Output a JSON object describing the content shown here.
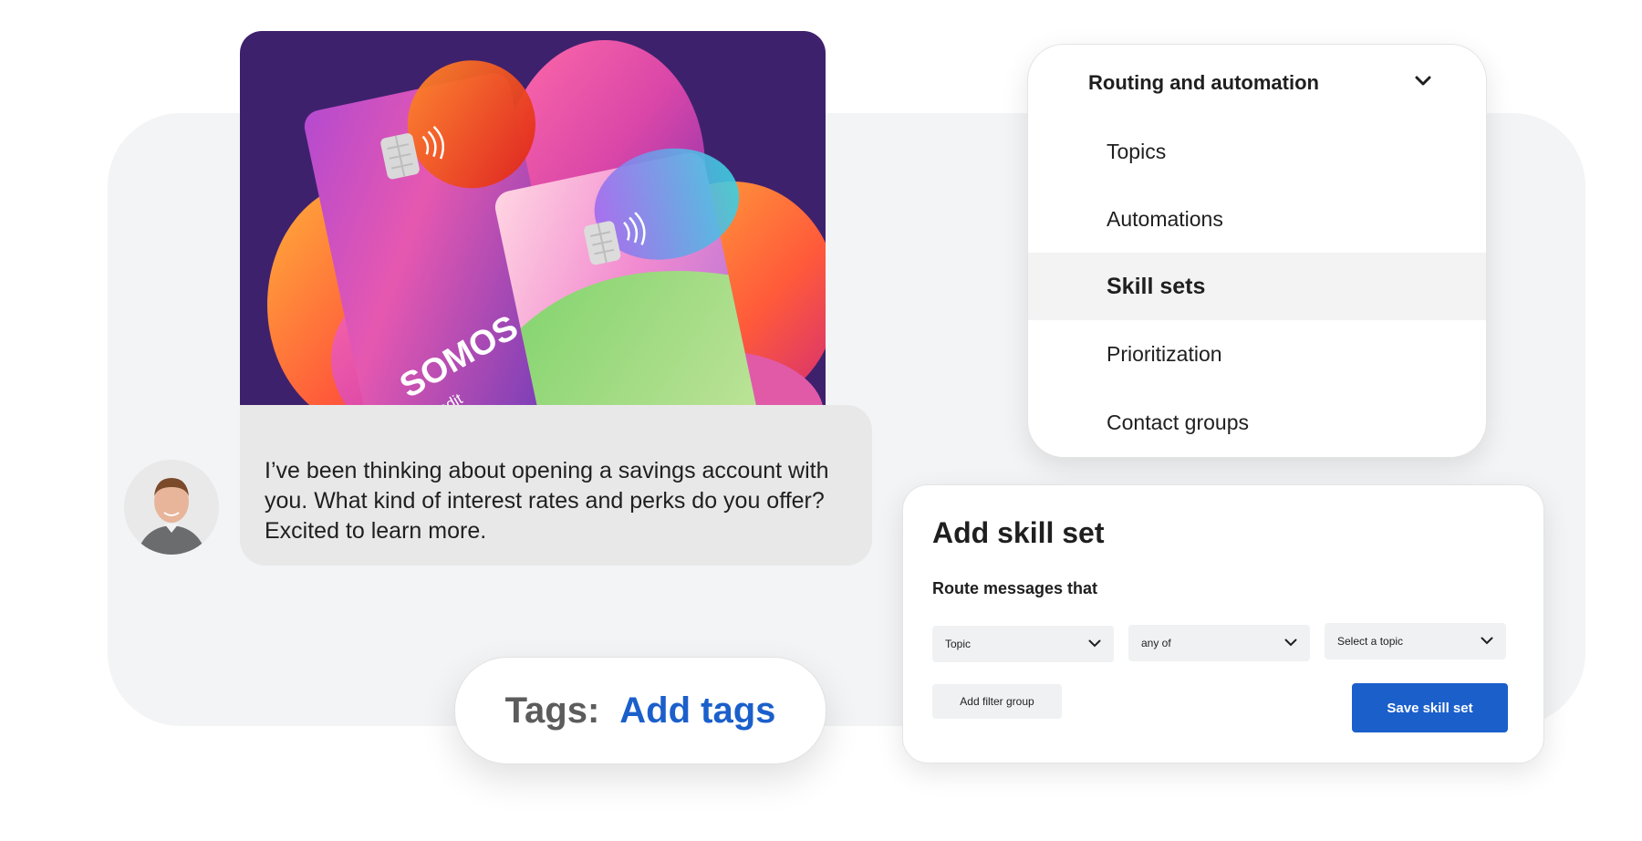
{
  "colors": {
    "accent_blue": "#1b5fcb",
    "panel_bg": "#f3f4f6",
    "chat_bubble": "#e8e8e8",
    "card_image_bg": "#3e216d"
  },
  "promo_image": {
    "brand": "SOMOS",
    "card_type": "Credit"
  },
  "chat": {
    "message": "I’ve been thinking about opening a savings account with you. What kind of interest rates and perks do you offer? Excited to learn more."
  },
  "routing_menu": {
    "header": "Routing and automation",
    "header_icon": "chevron-down-icon",
    "items": [
      {
        "label": "Topics",
        "active": false
      },
      {
        "label": "Automations",
        "active": false
      },
      {
        "label": "Skill sets",
        "active": true
      },
      {
        "label": "Prioritization",
        "active": false
      },
      {
        "label": "Contact groups",
        "active": false
      }
    ]
  },
  "skill_set": {
    "title": "Add skill set",
    "subtitle": "Route messages that",
    "selects": [
      {
        "value": "Topic"
      },
      {
        "value": "any of"
      },
      {
        "value": "Select a topic"
      }
    ],
    "add_filter_label": "Add filter group",
    "save_label": "Save skill set"
  },
  "tags": {
    "label": "Tags:",
    "link": "Add tags"
  }
}
